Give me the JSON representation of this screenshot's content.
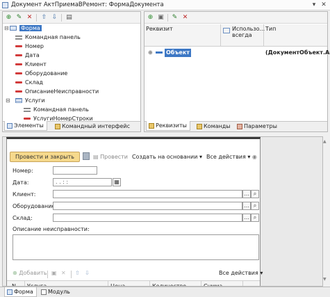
{
  "window": {
    "title": "Документ АктПриемаВРемонт: ФормаДокумента",
    "pin_icon": "pin-icon",
    "close_icon": "close-icon"
  },
  "elements_panel": {
    "toolbar_icons": [
      "add-icon",
      "edit-icon",
      "delete-icon",
      "move-up-icon",
      "move-down-icon",
      "more-icon"
    ],
    "tree": [
      {
        "label": "Форма",
        "icon": "form-icon",
        "level": 0,
        "selected": true
      },
      {
        "label": "Командная панель",
        "icon": "command-bar-icon",
        "level": 1
      },
      {
        "label": "Номер",
        "icon": "field-icon",
        "level": 1
      },
      {
        "label": "Дата",
        "icon": "field-icon",
        "level": 1
      },
      {
        "label": "Клиент",
        "icon": "field-icon",
        "level": 1
      },
      {
        "label": "Оборудование",
        "icon": "field-icon",
        "level": 1
      },
      {
        "label": "Склад",
        "icon": "field-icon",
        "level": 1
      },
      {
        "label": "ОписаниеНеисправности",
        "icon": "field-icon",
        "level": 1
      },
      {
        "label": "Услуги",
        "icon": "table-icon",
        "level": 1
      },
      {
        "label": "Командная панель",
        "icon": "command-bar-icon",
        "level": 2
      },
      {
        "label": "УслугиНомерСтроки",
        "icon": "field-icon",
        "level": 2
      }
    ],
    "tabs": [
      "Элементы",
      "Командный интерфейс"
    ]
  },
  "attributes_panel": {
    "toolbar_icons": [
      "add-attribute-icon",
      "copy-icon",
      "edit-icon",
      "delete-icon"
    ],
    "columns": [
      "Реквизит",
      "Использо... всегда",
      "Тип"
    ],
    "rows": [
      {
        "name": "Объект",
        "type": "(ДокументОбъект.Акт"
      }
    ],
    "tabs": [
      "Реквизиты",
      "Команды",
      "Параметры"
    ]
  },
  "preview": {
    "post_and_close": "Провести и закрыть",
    "post": "Провести",
    "create_based_on": "Создать на основании",
    "all_actions": "Все действия",
    "fields": [
      {
        "label": "Номер:",
        "value": ""
      },
      {
        "label": "Дата:",
        "value": ". .  : :"
      },
      {
        "label": "Клиент:",
        "value": ""
      },
      {
        "label": "Оборудование:",
        "value": ""
      },
      {
        "label": "Склад:",
        "value": ""
      }
    ],
    "description_label": "Описание неисправности:",
    "table_toolbar": {
      "add": "Добавить",
      "all_actions": "Все действия"
    },
    "table_columns": [
      "N",
      "Услуга",
      "Цена",
      "Количество",
      "Сумма"
    ]
  },
  "bottom_tabs": [
    "Форма",
    "Модуль"
  ]
}
